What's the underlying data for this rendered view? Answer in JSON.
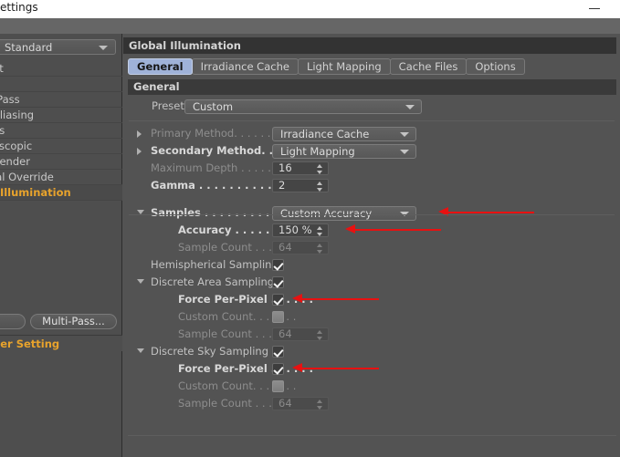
{
  "window": {
    "title": "ettings",
    "minimize_label": "minimize"
  },
  "sidebar": {
    "preset_dropdown": {
      "value": "Standard"
    },
    "items": [
      {
        "label": "ut",
        "selected": false
      },
      {
        "label": "",
        "selected": false
      },
      {
        "label": "-Pass",
        "selected": false
      },
      {
        "label": "Aliasing",
        "selected": false
      },
      {
        "label": "ns",
        "selected": false
      },
      {
        "label": "oscopic",
        "selected": false
      },
      {
        "label": "Render",
        "selected": false
      },
      {
        "label": "ial Override",
        "selected": false
      },
      {
        "label": "l Illumination",
        "selected": true
      }
    ],
    "buttons": {
      "effect_label": "",
      "multipass_label": "Multi-Pass..."
    },
    "render_setting_label": "der Setting"
  },
  "panel": {
    "header_title": "Global Illumination",
    "tabs": [
      {
        "label": "General",
        "active": true
      },
      {
        "label": "Irradiance Cache",
        "active": false
      },
      {
        "label": "Light Mapping",
        "active": false
      },
      {
        "label": "Cache Files",
        "active": false
      },
      {
        "label": "Options",
        "active": false
      }
    ],
    "section_title": "General",
    "preset_row": {
      "label": "Preset",
      "value": "Custom"
    },
    "rows": [
      {
        "id": "primary-method",
        "label": "Primary Method. . . . . . .",
        "label_style": "dim",
        "triangle": "right",
        "control": "dropdown",
        "value": "Irradiance Cache"
      },
      {
        "id": "secondary-method",
        "label": "Secondary Method. . . .",
        "label_style": "bold",
        "triangle": "right",
        "control": "dropdown",
        "value": "Light Mapping"
      },
      {
        "id": "maximum-depth",
        "label": "Maximum Depth . . . . . .",
        "label_style": "dim",
        "triangle": "none",
        "control": "number",
        "value": "16"
      },
      {
        "id": "gamma",
        "label": "Gamma . . . . . . . . . . . . .",
        "label_style": "bold",
        "triangle": "none",
        "control": "number",
        "value": "2"
      },
      {
        "id": "samples",
        "label": "Samples . . . . . . . . . . . .",
        "label_style": "bold",
        "triangle": "down",
        "control": "dropdown",
        "value": "Custom Accuracy",
        "annotated": true
      },
      {
        "id": "accuracy",
        "label": "Accuracy . . . . . . . . . .",
        "label_style": "bold",
        "triangle": "none",
        "control": "number",
        "value": "150 %",
        "annotated": true
      },
      {
        "id": "sample-count-1",
        "label": "Sample Count . . . . . . .",
        "label_style": "dim",
        "triangle": "none",
        "control": "number-dim",
        "value": "64"
      },
      {
        "id": "hemispherical-sampling",
        "label": "Hemispherical Sampling",
        "label_style": "normal",
        "triangle": "none",
        "control": "checkbox-on",
        "value": ""
      },
      {
        "id": "discrete-area-sampling",
        "label": "Discrete Area Sampling",
        "label_style": "normal",
        "triangle": "down",
        "control": "checkbox-on",
        "value": ""
      },
      {
        "id": "force-per-pixel-area",
        "label": "Force Per-Pixel . . . . . .",
        "label_style": "bold",
        "triangle": "none",
        "control": "checkbox-on",
        "value": "",
        "annotated": true
      },
      {
        "id": "custom-count-area",
        "label": "Custom Count. . . . . . .",
        "label_style": "dim",
        "triangle": "none",
        "control": "checkbox-off",
        "value": ""
      },
      {
        "id": "sample-count-2",
        "label": "Sample Count . . . . . . .",
        "label_style": "dim",
        "triangle": "none",
        "control": "number-dim",
        "value": "64"
      },
      {
        "id": "discrete-sky-sampling",
        "label": "Discrete Sky Sampling .",
        "label_style": "normal",
        "triangle": "down",
        "control": "checkbox-on",
        "value": ""
      },
      {
        "id": "force-per-pixel-sky",
        "label": "Force Per-Pixel . . . . . .",
        "label_style": "bold",
        "triangle": "none",
        "control": "checkbox-on",
        "value": "",
        "annotated": true
      },
      {
        "id": "custom-count-sky",
        "label": "Custom Count. . . . . . .",
        "label_style": "dim",
        "triangle": "none",
        "control": "checkbox-off",
        "value": ""
      },
      {
        "id": "sample-count-3",
        "label": "Sample Count . . . . . . .",
        "label_style": "dim",
        "triangle": "none",
        "control": "number-dim",
        "value": "64"
      }
    ]
  },
  "colors": {
    "accent_selected": "#e8a32c",
    "tab_active": "#9fb2d8",
    "annotation": "#e81111",
    "panel_bg": "#535353",
    "header_bg": "#333333"
  }
}
